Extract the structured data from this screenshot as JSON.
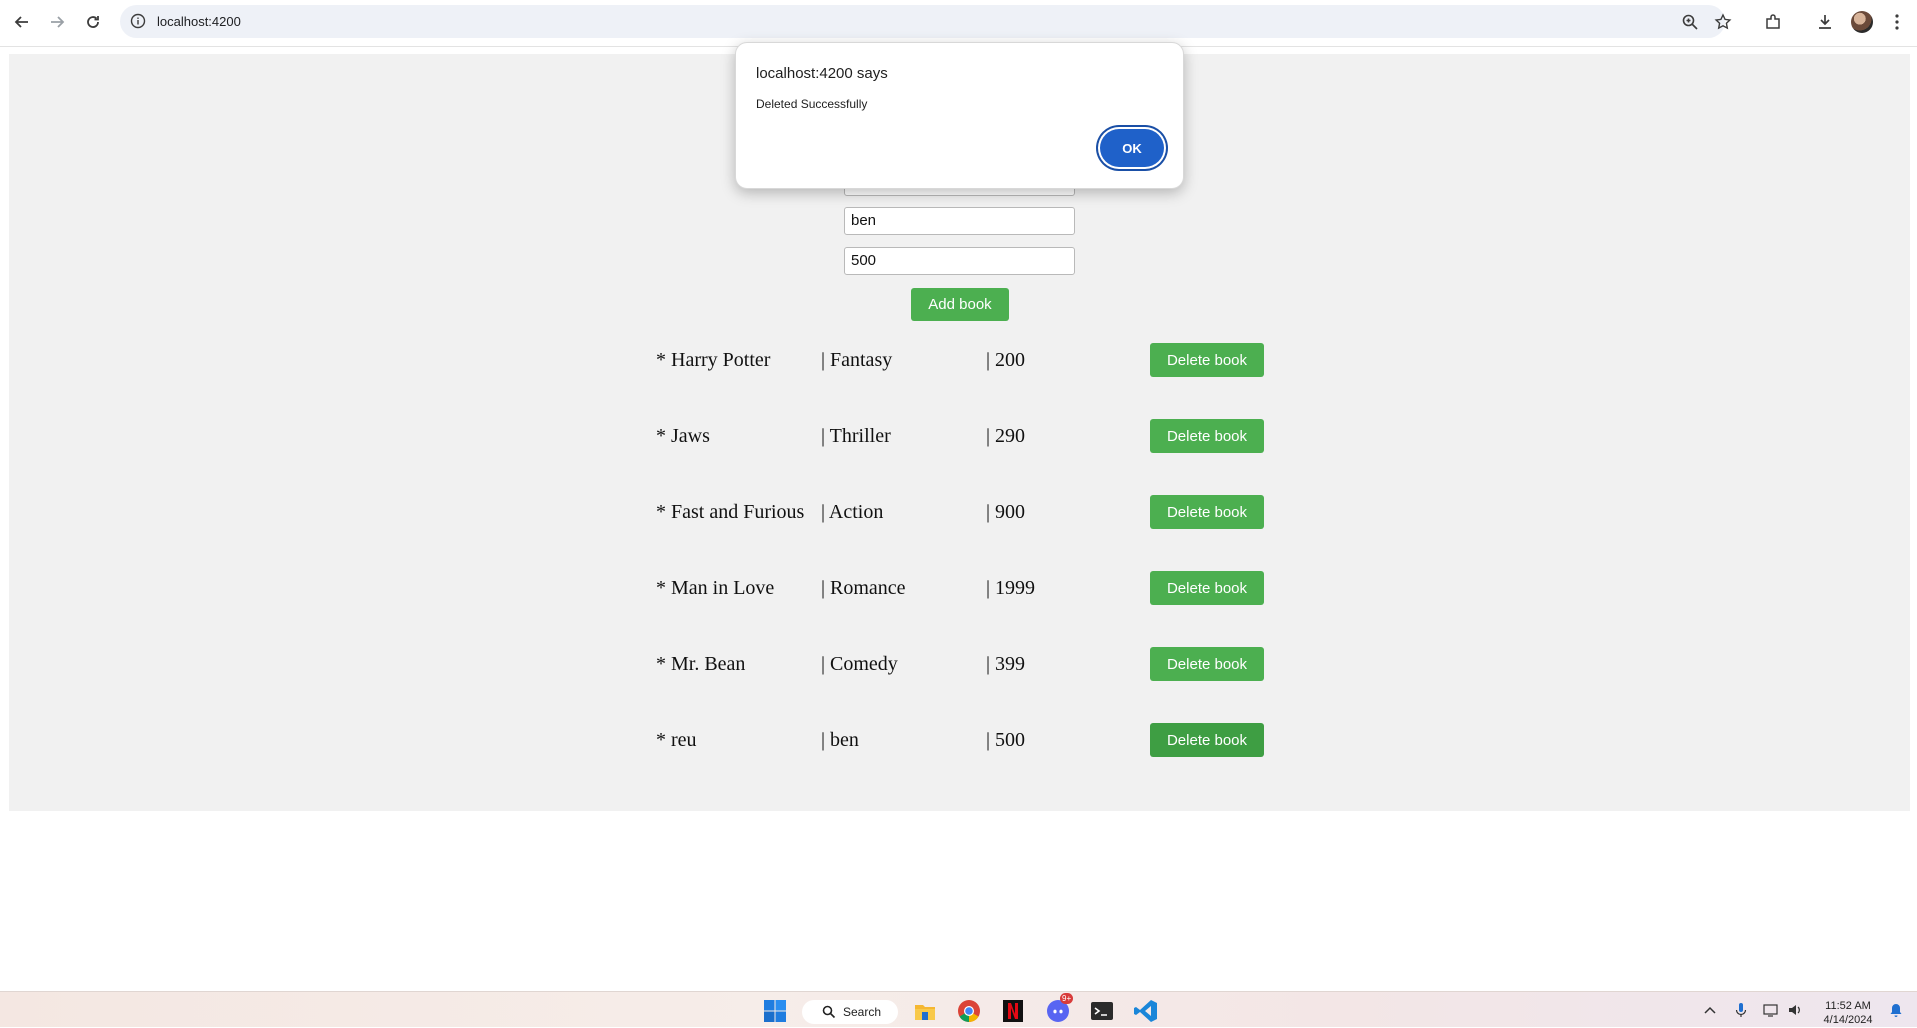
{
  "browser": {
    "url": "localhost:4200"
  },
  "form": {
    "author_value": "ben",
    "price_value": "500",
    "add_label": "Add book"
  },
  "books": [
    {
      "title": "* Harry Potter",
      "genre": "| Fantasy",
      "price": "| 200"
    },
    {
      "title": "* Jaws",
      "genre": "| Thriller",
      "price": "| 290"
    },
    {
      "title": "* Fast and Furious",
      "genre": "| Action",
      "price": "| 900"
    },
    {
      "title": "* Man in Love",
      "genre": "| Romance",
      "price": "| 1999"
    },
    {
      "title": "* Mr. Bean",
      "genre": "| Comedy",
      "price": "| 399"
    },
    {
      "title": "* reu",
      "genre": "| ben",
      "price": "| 500"
    }
  ],
  "delete_label": "Delete book",
  "dialog": {
    "title": "localhost:4200 says",
    "message": "Deleted Successfully",
    "ok_label": "OK"
  },
  "taskbar": {
    "search_label": "Search",
    "discord_badge": "9+",
    "time": "11:52 AM",
    "date": "4/14/2024"
  },
  "colors": {
    "accent": "#4caf50",
    "dialog_button": "#1f61c9",
    "page_bg": "#f1f1f1"
  }
}
